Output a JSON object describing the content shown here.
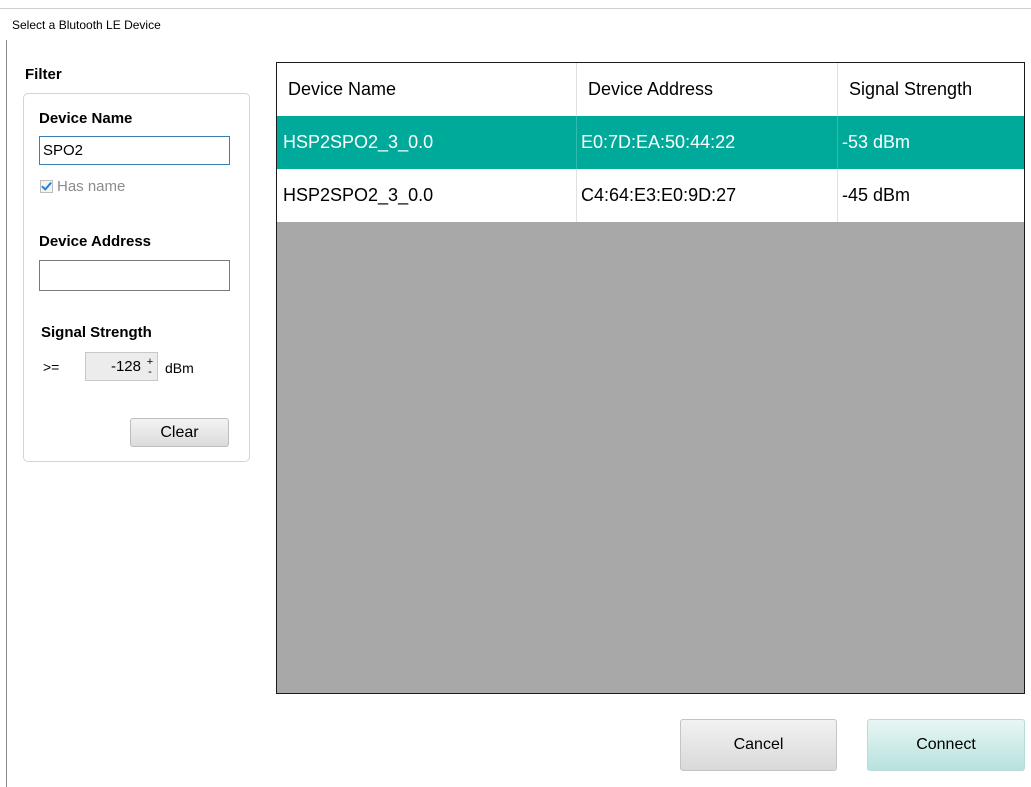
{
  "window": {
    "title": "Select a Blutooth LE Device"
  },
  "filter": {
    "title": "Filter",
    "device_name_label": "Device Name",
    "device_name_value": "SPO2",
    "has_name_label": "Has name",
    "has_name_checked": true,
    "device_address_label": "Device Address",
    "device_address_value": "",
    "signal_strength_label": "Signal Strength",
    "comparator": ">=",
    "signal_min": "-128",
    "signal_unit": "dBm",
    "stepper_up": "+",
    "stepper_down": "-",
    "clear_label": "Clear"
  },
  "table": {
    "columns": [
      "Device Name",
      "Device Address",
      "Signal Strength"
    ],
    "rows": [
      {
        "name": "HSP2SPO2_3_0.0",
        "address": "E0:7D:EA:50:44:22",
        "signal": "-53 dBm",
        "selected": true
      },
      {
        "name": "HSP2SPO2_3_0.0",
        "address": "C4:64:E3:E0:9D:27",
        "signal": "-45 dBm",
        "selected": false
      }
    ]
  },
  "actions": {
    "cancel_label": "Cancel",
    "connect_label": "Connect"
  },
  "colors": {
    "selection": "#00aa9a",
    "empty_area": "#a8a8a8",
    "connect_button": "#b8e2de"
  },
  "icons": {
    "check": "check-icon"
  }
}
